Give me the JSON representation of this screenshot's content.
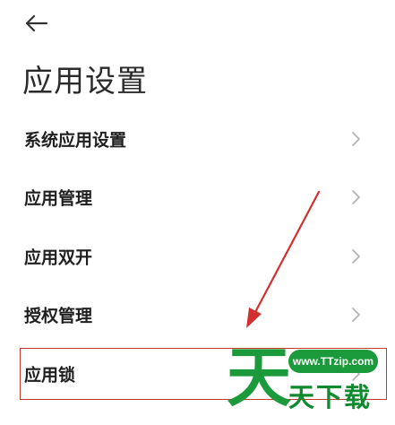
{
  "header": {
    "back_icon": "arrow-left-icon",
    "title": "应用设置"
  },
  "items": [
    {
      "label": "系统应用设置",
      "icon": "chevron-right-icon"
    },
    {
      "label": "应用管理",
      "icon": "chevron-right-icon"
    },
    {
      "label": "应用双开",
      "icon": "chevron-right-icon"
    },
    {
      "label": "授权管理",
      "icon": "chevron-right-icon"
    },
    {
      "label": "应用锁",
      "icon": "chevron-right-icon"
    }
  ],
  "annotation": {
    "color": "#d32f2f"
  },
  "watermark": {
    "url": "www.TTzip.com",
    "text": "天下载",
    "logo_glyph": "天",
    "color": "#1a9a3a"
  }
}
